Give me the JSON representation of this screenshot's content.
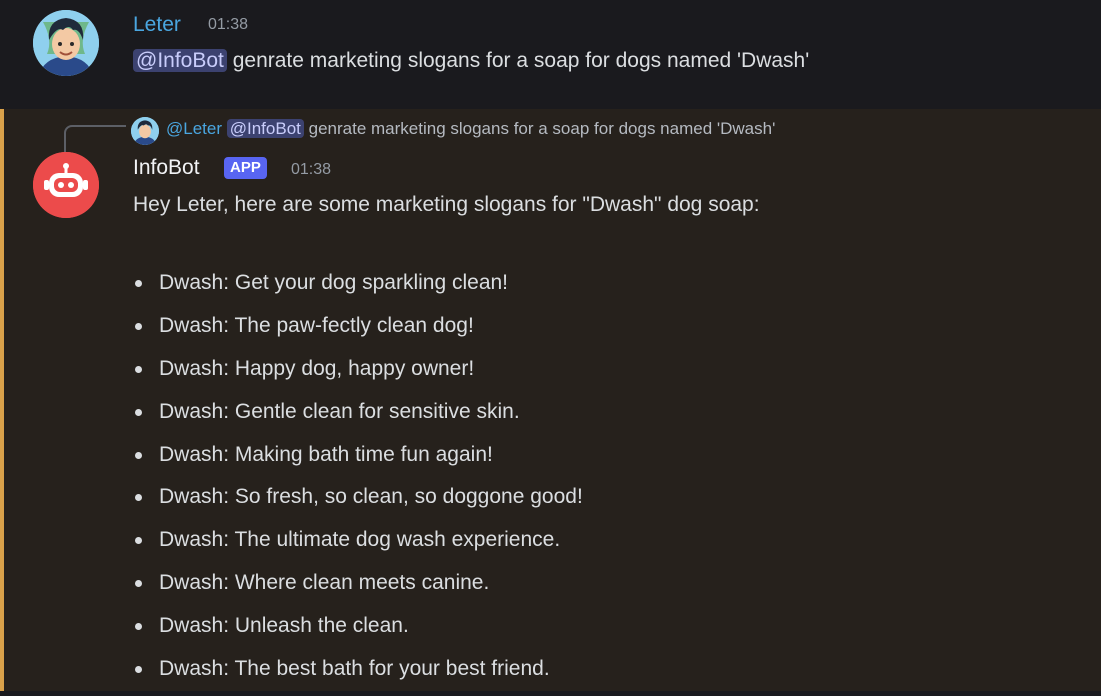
{
  "user_message": {
    "author": "Leter",
    "timestamp": "01:38",
    "mention": "@InfoBot",
    "text": "genrate marketing slogans for a soap for dogs named 'Dwash'"
  },
  "bot_message": {
    "reply_preview": {
      "author": "@Leter",
      "mention": "@InfoBot",
      "text": "genrate marketing slogans for a soap for dogs named 'Dwash'"
    },
    "author": "InfoBot",
    "badge": "APP",
    "timestamp": "01:38",
    "intro": "Hey Leter, here are some marketing slogans for \"Dwash\" dog soap:",
    "slogans": [
      "Dwash: Get your dog sparkling clean!",
      "Dwash: The paw-fectly clean dog!",
      "Dwash: Happy dog, happy owner!",
      "Dwash: Gentle clean for sensitive skin.",
      "Dwash: Making bath time fun again!",
      "Dwash: So fresh, so clean, so doggone good!",
      "Dwash: The ultimate dog wash experience.",
      "Dwash: Where clean meets canine.",
      "Dwash: Unleash the clean.",
      "Dwash: The best bath for your best friend."
    ]
  },
  "colors": {
    "user_name": "#4aa6e0",
    "mention_bg": "#3c4270",
    "bot_highlight_bar": "#d9a14a",
    "app_badge": "#5865f2",
    "bot_avatar": "#ec4b4b"
  },
  "icons": {
    "user_avatar": "anime-boy-avatar",
    "bot_avatar": "robot-face-icon"
  }
}
